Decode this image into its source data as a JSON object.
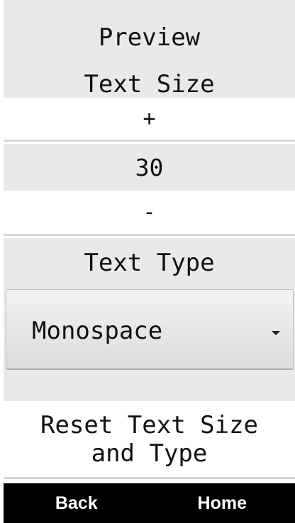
{
  "header": {
    "line1": "Preview",
    "line2": "Text Size"
  },
  "text_size": {
    "increase_label": "+",
    "value": "30",
    "decrease_label": "-"
  },
  "text_type": {
    "heading": "Text Type",
    "selected": "Monospace"
  },
  "reset": {
    "line1": "Reset Text Size",
    "line2": "and Type"
  },
  "nav": {
    "back_label": "Back",
    "home_label": "Home"
  }
}
